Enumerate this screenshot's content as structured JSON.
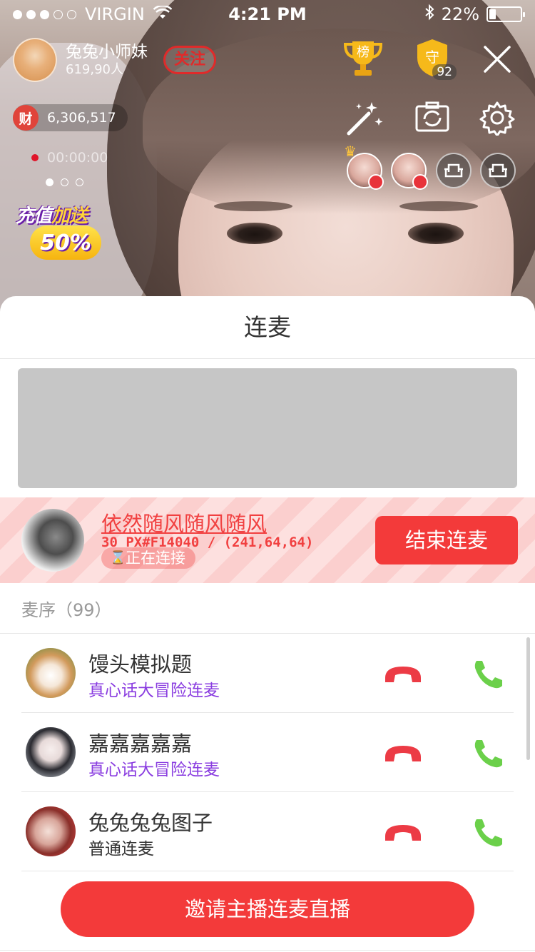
{
  "status_bar": {
    "carrier": "VIRGIN",
    "time": "4:21 PM",
    "battery": "22%",
    "battery_level": 0.22
  },
  "host": {
    "name": "兔兔小师妹",
    "fans": "619,90人",
    "follow_label": "关注"
  },
  "wealth": {
    "icon_label": "财",
    "value": "6,306,517"
  },
  "recording": {
    "timer": "00:00:00"
  },
  "promo": {
    "line1_part1": "充值",
    "line1_part2": "加送",
    "line2": "50%"
  },
  "top_icons": {
    "rank_label": "榜",
    "guard_label": "守",
    "guard_count": "92"
  },
  "sheet": {
    "title": "连麦"
  },
  "active_link": {
    "name": "依然随风随风随风",
    "note": "30 PX#F14040 / (241,64,64)",
    "status": "正在连接",
    "end_button": "结束连麦"
  },
  "queue": {
    "header": "麦序（99）",
    "items": [
      {
        "name": "馒头模拟题",
        "mode": "真心话大冒险连麦"
      },
      {
        "name": "嘉嘉嘉嘉嘉",
        "mode": "真心话大冒险连麦"
      },
      {
        "name": "兔兔兔兔图子",
        "mode": "普通连麦"
      }
    ]
  },
  "invite_button": "邀请主播连麦直播",
  "colors": {
    "accent_red": "#F14040",
    "button_red": "#F33A3A",
    "mode_purple": "#8A3DE0",
    "accept_green": "#6BD04A"
  }
}
